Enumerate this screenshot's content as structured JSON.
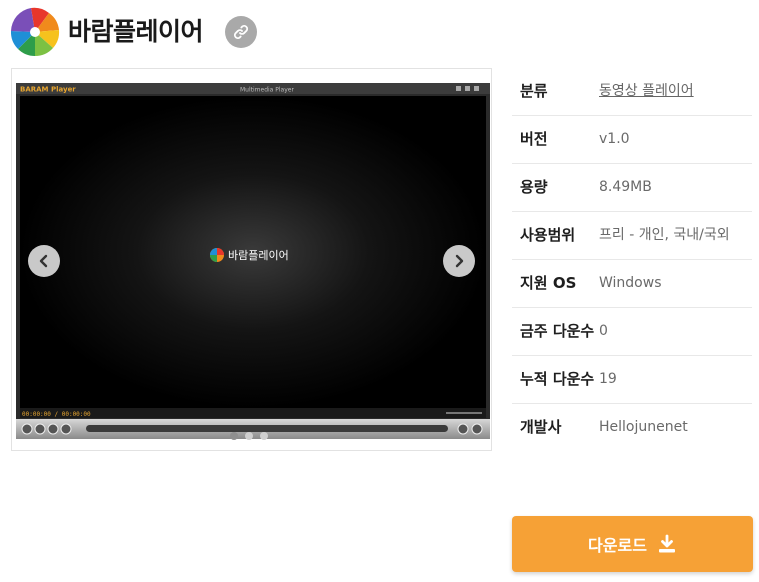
{
  "app": {
    "title": "바람플레이어"
  },
  "gallery": {
    "player_brand": "BARAM Player",
    "player_window_title": "Multimedia Player",
    "player_logo_text": "바람플레이어",
    "player_time": "00:00:00 / 00:00:00",
    "slide_count": 3,
    "active_slide": 1
  },
  "info": {
    "rows": [
      {
        "label": "분류",
        "value": "동영상 플레이어",
        "is_link": true
      },
      {
        "label": "버전",
        "value": "v1.0"
      },
      {
        "label": "용량",
        "value": "8.49MB"
      },
      {
        "label": "사용범위",
        "value": "프리 - 개인, 국내/국외"
      },
      {
        "label": "지원 OS",
        "value": "Windows"
      },
      {
        "label": "금주 다운수",
        "value": "0"
      },
      {
        "label": "누적 다운수",
        "value": "19"
      },
      {
        "label": "개발사",
        "value": "Hellojunenet"
      }
    ]
  },
  "download": {
    "label": "다운로드"
  },
  "colors": {
    "accent": "#f6a136",
    "link_button": "#a9a9a9",
    "player_bg": "#000000"
  },
  "icons": [
    "pinwheel-logo-icon",
    "link-icon",
    "chevron-left-icon",
    "chevron-right-icon",
    "download-icon"
  ]
}
